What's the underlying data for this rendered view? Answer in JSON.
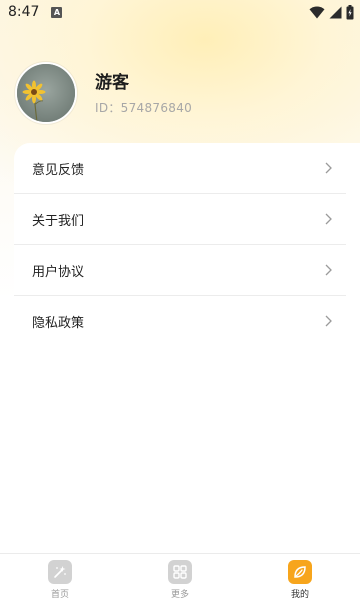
{
  "status_bar": {
    "time": "8:47",
    "notification_glyph": "A"
  },
  "profile": {
    "name": "游客",
    "user_id": "ID：574876840"
  },
  "menu": {
    "items": [
      {
        "label": "意见反馈",
        "icon": "chevron-right-icon"
      },
      {
        "label": "关于我们",
        "icon": "chevron-right-icon"
      },
      {
        "label": "用户协议",
        "icon": "chevron-right-icon"
      },
      {
        "label": "隐私政策",
        "icon": "chevron-right-icon"
      }
    ]
  },
  "tabbar": {
    "tabs": [
      {
        "label": "首页",
        "icon": "home-icon",
        "active": false
      },
      {
        "label": "更多",
        "icon": "grid-icon",
        "active": false
      },
      {
        "label": "我的",
        "icon": "leaf-icon",
        "active": true
      }
    ]
  },
  "colors": {
    "accent": "#f7a51c",
    "header_glow": "#ffefb8",
    "text_primary": "#222222",
    "text_secondary": "#a7a7a7"
  }
}
